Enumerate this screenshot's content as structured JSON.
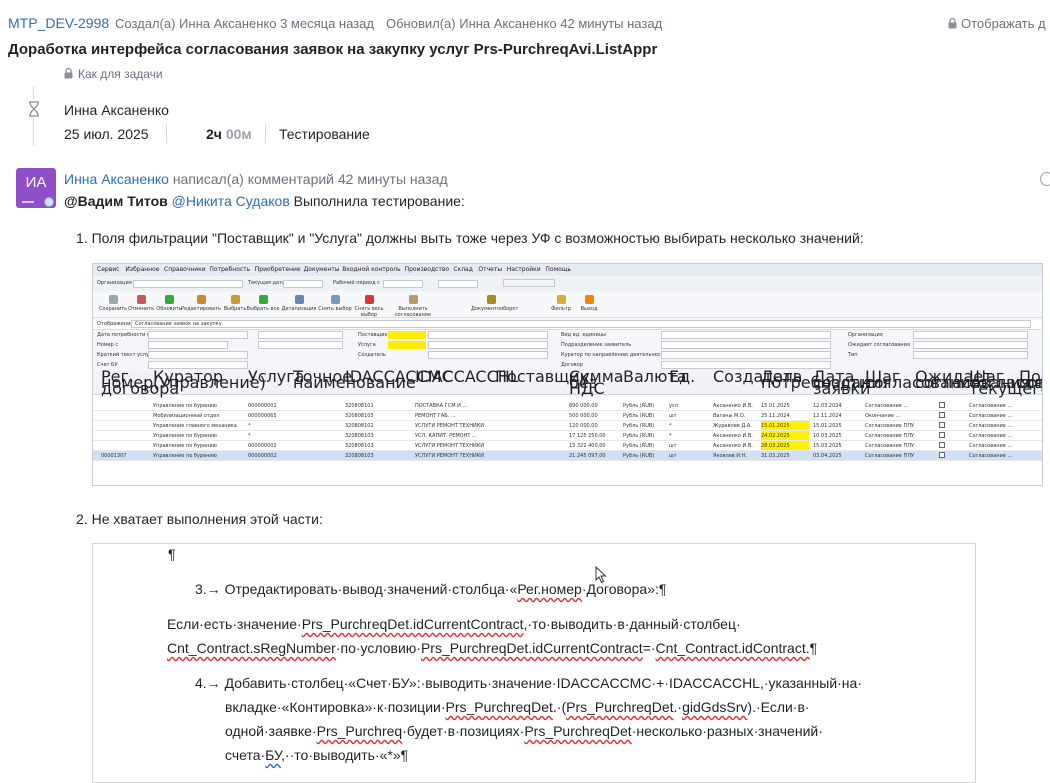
{
  "header": {
    "issue_key": "MTP_DEV-2998",
    "created": "Создал(а) Инна Аксаненко 3 месяца назад",
    "updated": "Обновил(а) Инна Аксаненко 42 минуты назад",
    "display_label": "Отображать д",
    "title": "Доработка интерфейса согласования заявок на закупку услуг Prs-PurchreqAvi.ListAppr"
  },
  "timeline": {
    "task_label": "Как для задачи",
    "worklog": {
      "author": "Инна Аксаненко",
      "date": "25 июл. 2025",
      "time_hours": "2ч",
      "time_minutes": "00м",
      "type": "Тестирование"
    }
  },
  "comment": {
    "avatar_initials": "ИА",
    "author": "Инна Аксаненко",
    "action": "написал(а) комментарий 42 минуты назад",
    "mention_1": "@Вадим Титов",
    "mention_2": "@Никита Судаков",
    "text": "Выполнила тестирование:",
    "list": [
      "Поля фильтрации \"Поставщик\" и \"Услуга\" должны выть тоже через УФ с возможностью выбирать несколько значений:",
      "Не хватает выполнения этой части:"
    ]
  },
  "embedded_screenshot": {
    "menu": [
      "Сервис",
      "Избранное",
      "Справочники",
      "Потребность",
      "Приобретение",
      "Документы",
      "Входной контроль",
      "Производство",
      "Склад",
      "Отчеты",
      "Настройки",
      "Помощь"
    ],
    "toolbar": [
      "Сохранить",
      "Отменить",
      "Обновить",
      "Редактировать",
      "Выбрать",
      "Выбрать все",
      "Детализация",
      "Снять выбор",
      "Снять весь выбор",
      "Выполнить согласование",
      "Документооборот",
      "Фильтр",
      "Выход"
    ],
    "display_label": "Отображение",
    "display_value": "Согласование заявок на закупку",
    "filters_left": [
      "Дата потребности с",
      "Номер с",
      "Краткий текст услуги",
      "Счет БУ"
    ],
    "filters_mid": [
      "Поставщик",
      "Услуга",
      "Создатель"
    ],
    "filters_right": [
      "Вид ед. единицы",
      "Подразделение заявитель",
      "Куратор по направлению деятельности",
      "Договор"
    ],
    "filters_far": [
      "Организация",
      "Ожидает согласования",
      "Тип"
    ],
    "columns": [
      "Рег. номер договора",
      "Куратор (Управление)",
      "Услуга",
      "Точное наименование",
      "IDACCACCMC",
      "IDACCACCHL",
      "Поставщик",
      "Сумма без НДС",
      "Валюта",
      "Ед.",
      "Создатель",
      "Дата потребности",
      "Дата создания заявки",
      "Шаг согласования",
      "Ожидает согласования",
      "Шаг согласования текущего",
      "Последнее согласующее"
    ],
    "rows": [
      {
        "reg": "",
        "cur": "Управление по бурению",
        "svc": "000000001",
        "acmc": "320808101",
        "achl": "ПОСТАВКА ГСМ И ...",
        "sum": "890 000,00",
        "cur2": "Рубль (RUB)",
        "unit": "усл",
        "by": "Аксаненко И.В.",
        "need": "15.01.2025",
        "created": "12.03.2024",
        "step": "Согласование ..."
      },
      {
        "reg": "",
        "cur": "Мобилизационный отдел",
        "svc": "000000065",
        "acmc": "320808105",
        "achl": "РЕМОНТ ГАБ. ...",
        "sum": "500 000,00",
        "cur2": "Рубль (RUB)",
        "unit": "шт",
        "by": "Ваганы М.О.",
        "need": "25.11.2024",
        "created": "12.11.2024",
        "step": "Окончание ..."
      },
      {
        "reg": "",
        "cur": "Управление главного механика",
        "svc": "*",
        "acmc": "320808102",
        "achl": "УСЛУГИ РЕМОНТ ТЕХНИКИ",
        "sum": "120 000,00",
        "cur2": "Рубль (RUB)",
        "unit": "*",
        "by": "Журавлев Д.А.",
        "need": "15.01.2025",
        "created": "15.01.2025",
        "step": "Согласование ПЛУ"
      },
      {
        "reg": "",
        "cur": "Управление по бурению",
        "svc": "*",
        "acmc": "320808103",
        "achl": "УСЛ. КАПИТ. РЕМОНТ ...",
        "sum": "17 125 250,00",
        "cur2": "Рубль (RUB)",
        "unit": "*",
        "by": "Аксаненко И.В.",
        "need": "24.02.2025",
        "created": "10.03.2025",
        "step": "Согласование ПЛУ"
      },
      {
        "reg": "",
        "cur": "Управление по бурению",
        "svc": "000000002",
        "acmc": "320808103",
        "achl": "УСЛУГИ РЕМОНТ ТЕХНИКИ",
        "sum": "13 322 400,00",
        "cur2": "Рубль (RUB)",
        "unit": "шт",
        "by": "Аксаненко И.В.",
        "need": "28.03.2025",
        "created": "15.03.2025",
        "step": "Согласование ПЛУ"
      },
      {
        "reg": "00001307",
        "cur": "Управление по бурению",
        "svc": "000000002",
        "acmc": "320808103",
        "achl": "УСЛУГИ РЕМОНТ ТЕХНИКИ",
        "sum": "21 245 097,00",
        "cur2": "Рубль (RUB)",
        "unit": "шт",
        "by": "Яковлев И.Н.",
        "need": "31.03.2025",
        "created": "03.04.2025",
        "step": "Согласование ПЛУ"
      }
    ]
  },
  "doc_excerpt": {
    "pilcrow": "¶",
    "item3_num": "3.→",
    "item3_pre": "Отредактировать·вывод·значений·столбца·«",
    "item3_reg": "Рег.номер",
    "item3_post": "·Договора»:¶",
    "p1_a": "Если·есть·значение·",
    "p1_b": "Prs_PurchreqDet.idCurrentContract",
    "p1_c": ",·то·выводить·в·данный·столбец·",
    "p2_a": "Cnt_Contract.sRegNumber",
    "p2_b": "·по·условию·",
    "p2_c": "Prs_PurchreqDet.idCurrentContract",
    "p2_d": "=·",
    "p2_e": "Cnt_Contract.idContract.",
    "p2_f": "¶",
    "item4_num": "4.→",
    "item4_l1": "Добавить·столбец·«Счет·БУ»:·выводить·значение·IDACCACCMC·+·IDACCACCHL,·указанный·на·",
    "item4_l2a": "вкладке·«Контировка»·к·позиции·",
    "item4_l2b": "Prs_PurchreqDet",
    "item4_l2c": ".·(",
    "item4_l2d": "Prs_PurchreqDet",
    "item4_l2e": ".·",
    "item4_l2f": "gidGdsSrv",
    "item4_l2g": ").·Если·в·",
    "item4_l3a": "одной·заявке·",
    "item4_l3b": "Prs_Purchreq",
    "item4_l3c": "·будет·в·позициях·",
    "item4_l3d": "Prs_PurchreqDet",
    "item4_l3e": "·несколько·разных·значений·",
    "item4_l4a": "счета·",
    "item4_l4b": "БУ",
    "item4_l4c": ",··то·выводить·«*»¶"
  },
  "colors": {
    "link": "#2f6fb3",
    "avatar": "#8e4fc9",
    "highlight": "#ffee00"
  }
}
